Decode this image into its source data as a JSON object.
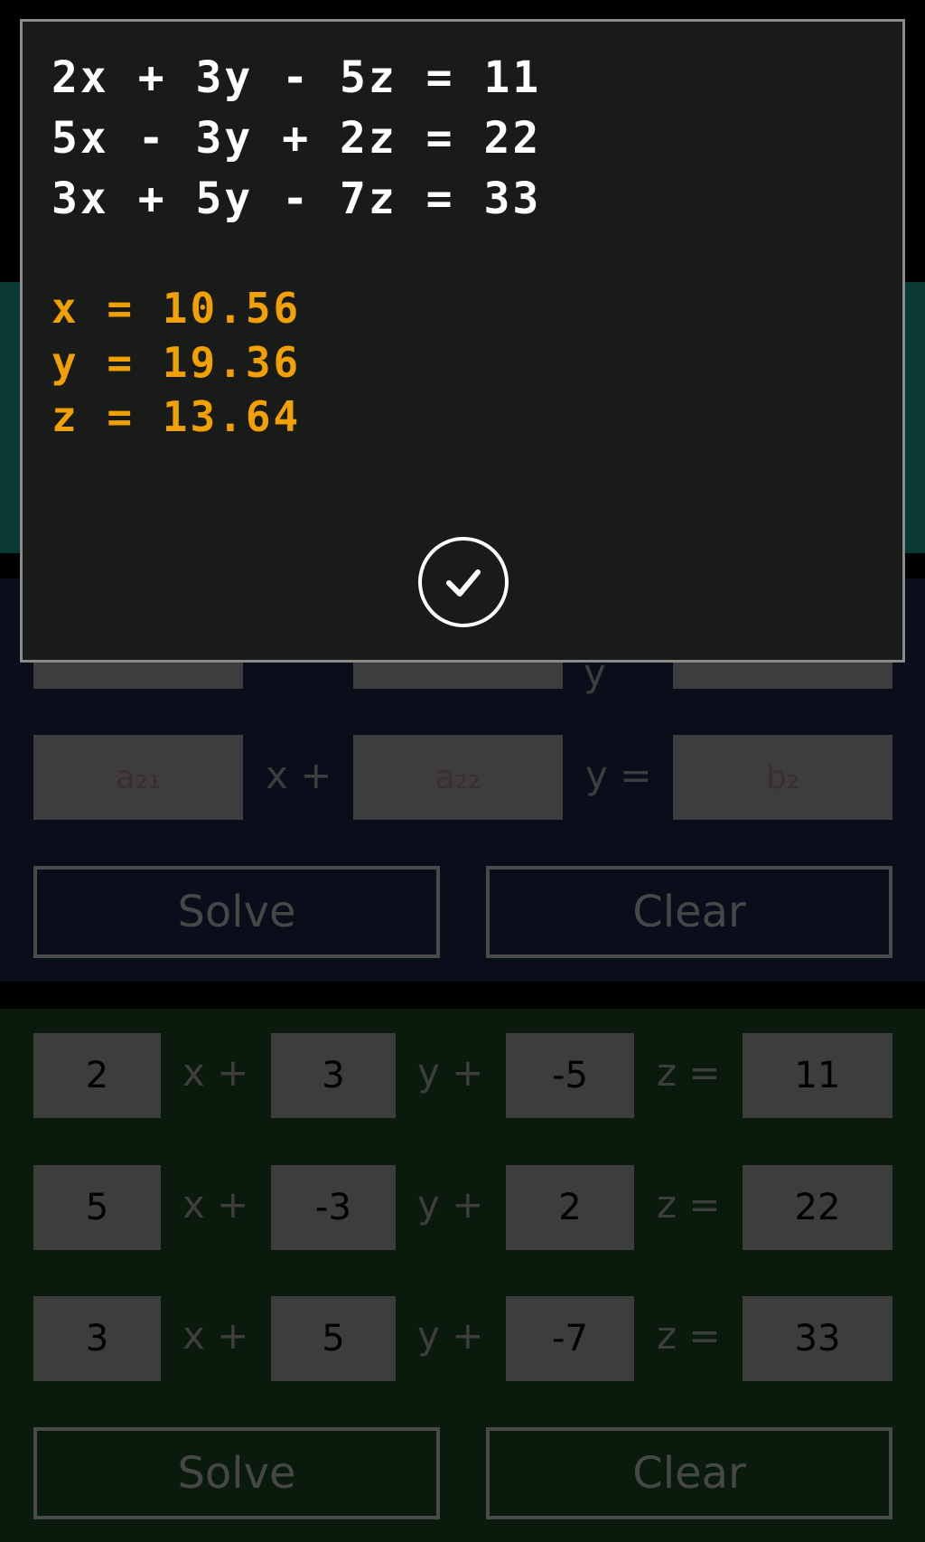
{
  "dialog": {
    "equations": [
      "2x + 3y - 5z = 11",
      "5x - 3y + 2z = 22",
      "3x + 5y - 7z = 33"
    ],
    "results": [
      "x = 10.56",
      "y = 19.36",
      "z = 13.64"
    ],
    "ok_icon": "checkmark-circle-icon"
  },
  "two_var": {
    "row2": {
      "a21": "a₂₁",
      "op1": "x +",
      "a22": "a₂₂",
      "op2": "y =",
      "b2": "b₂"
    },
    "op_row1": "y",
    "solve_label": "Solve",
    "clear_label": "Clear"
  },
  "three_var": {
    "rows": [
      {
        "a": "2",
        "op_x": "x +",
        "b": "3",
        "op_y": "y +",
        "c": "-5",
        "op_z": "z =",
        "d": "11"
      },
      {
        "a": "5",
        "op_x": "x +",
        "b": "-3",
        "op_y": "y +",
        "c": "2",
        "op_z": "z =",
        "d": "22"
      },
      {
        "a": "3",
        "op_x": "x +",
        "b": "5",
        "op_y": "y +",
        "c": "-7",
        "op_z": "z =",
        "d": "33"
      }
    ],
    "solve_label": "Solve",
    "clear_label": "Clear"
  },
  "colors": {
    "result": "#f0a000",
    "dialog_bg": "#191b18",
    "teal": "#0b3a35"
  }
}
